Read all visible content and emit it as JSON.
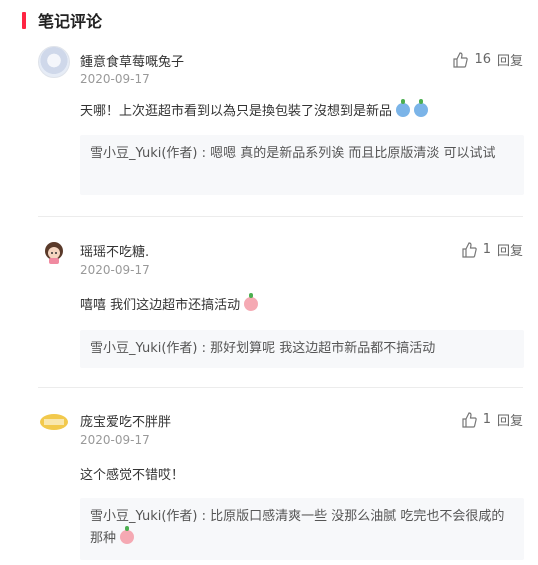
{
  "section": {
    "title": "笔记评论"
  },
  "comments": [
    {
      "username": "鍾意食草莓嘅兔子",
      "date": "2020-09-17",
      "likes": "16",
      "reply_label": "回复",
      "text": "天哪！上次逛超市看到以為只是換包裝了沒想到是新品",
      "emojis": [
        "crying-emoji",
        "crying-emoji"
      ],
      "author_reply": "雪小豆_Yuki(作者) : 嗯嗯 真的是新品系列诶 而且比原版清淡 可以试试"
    },
    {
      "username": "瑶瑶不吃糖.",
      "date": "2020-09-17",
      "likes": "1",
      "reply_label": "回复",
      "text": "嘻嘻 我们这边超市还搞活动",
      "emojis": [
        "peach-emoji"
      ],
      "author_reply": "雪小豆_Yuki(作者) : 那好划算呢 我这边超市新品都不搞活动"
    },
    {
      "username": "庞宝爱吃不胖胖",
      "date": "2020-09-17",
      "likes": "1",
      "reply_label": "回复",
      "text": "这个感觉不错哎！",
      "emojis": [],
      "author_reply": "雪小豆_Yuki(作者) : 比原版口感清爽一些 没那么油腻 吃完也不会很咸的那种",
      "author_reply_emoji": "peach-emoji"
    }
  ],
  "colors": {
    "accent": "#ff2442",
    "reply_bg": "#f7f8fa",
    "muted": "#999999"
  }
}
